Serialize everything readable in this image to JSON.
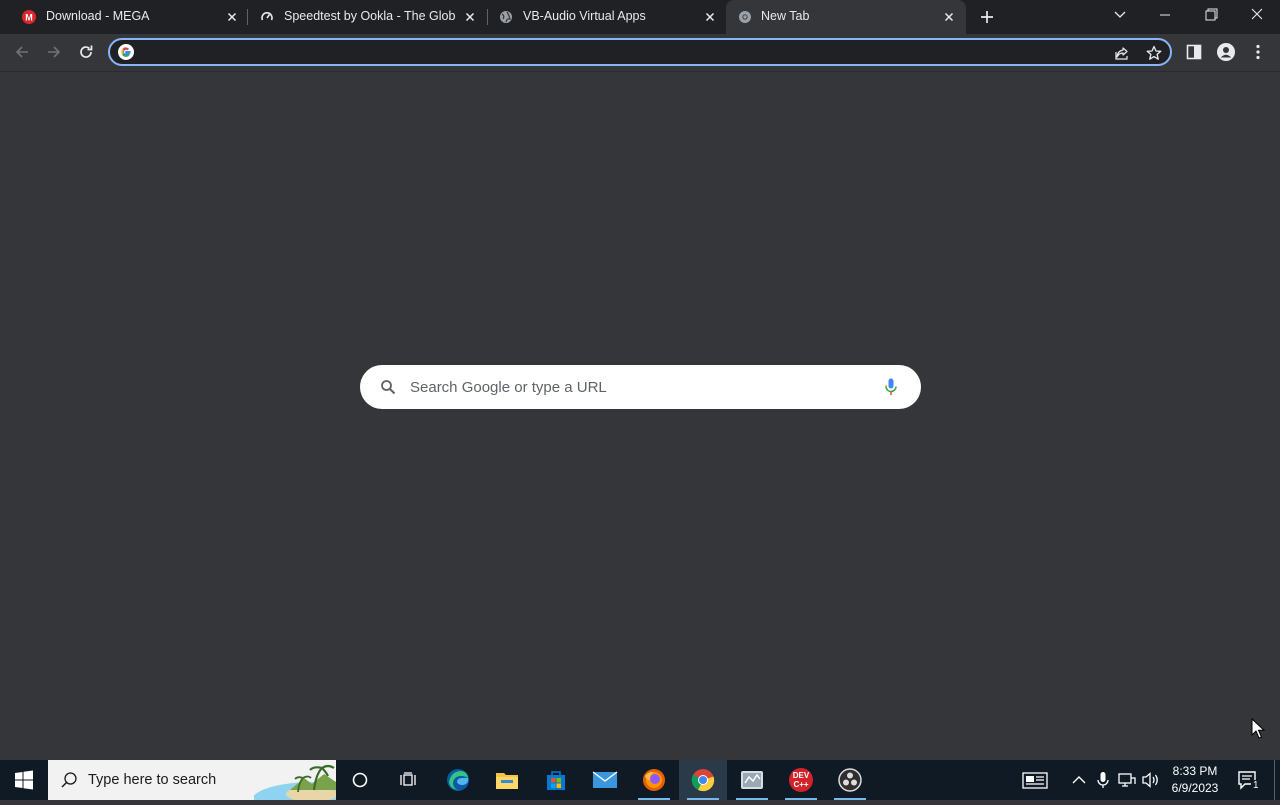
{
  "browser": {
    "tabs": [
      {
        "title": "Download - MEGA",
        "favicon": "mega-icon",
        "active": false
      },
      {
        "title": "Speedtest by Ookla - The Global",
        "favicon": "speedtest-icon",
        "active": false
      },
      {
        "title": "VB-Audio Virtual Apps",
        "favicon": "globe-icon",
        "active": false
      },
      {
        "title": "New Tab",
        "favicon": "chrome-icon",
        "active": true
      }
    ],
    "omnibox": {
      "value": "",
      "placeholder": ""
    },
    "colors": {
      "frame": "#202124",
      "toolbar": "#35363a",
      "focus_ring": "#8ab4f8"
    }
  },
  "ntp": {
    "search_placeholder": "Search Google or type a URL"
  },
  "taskbar": {
    "search_text": "Type here to search",
    "apps": [
      "cortana-icon",
      "task-view-icon",
      "edge-icon",
      "file-explorer-icon",
      "microsoft-store-icon",
      "mail-icon",
      "firefox-icon",
      "chrome-icon",
      "audio-app-icon",
      "dev-cpp-icon",
      "obs-icon"
    ],
    "dev_badge_top": "DEV",
    "dev_badge_bottom": "C++",
    "clock": {
      "time": "8:33 PM",
      "date": "6/9/2023"
    },
    "notification_count": "1"
  }
}
